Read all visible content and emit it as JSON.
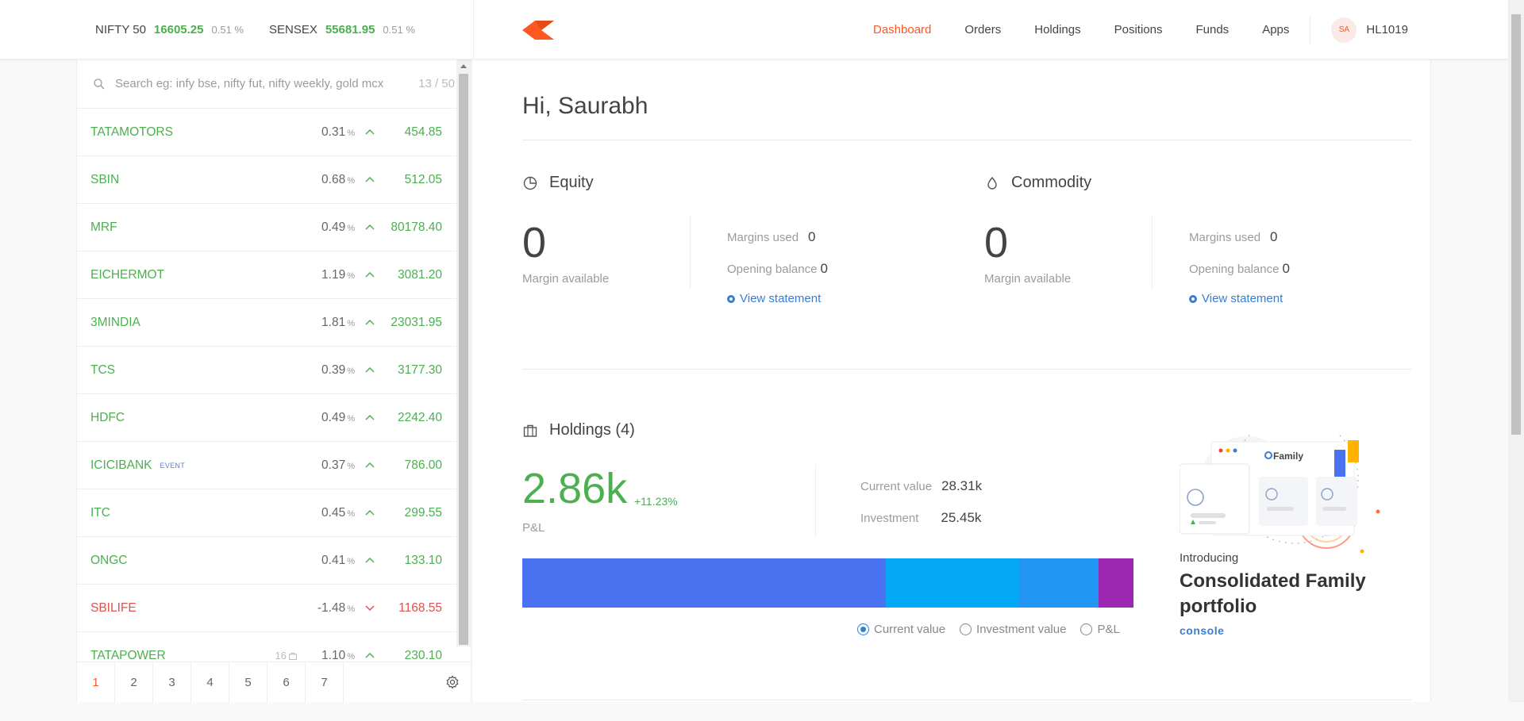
{
  "indices": [
    {
      "name": "NIFTY 50",
      "value": "16605.25",
      "pct": "0.51 %"
    },
    {
      "name": "SENSEX",
      "value": "55681.95",
      "pct": "0.51 %"
    }
  ],
  "nav": {
    "items": [
      "Dashboard",
      "Orders",
      "Holdings",
      "Positions",
      "Funds",
      "Apps"
    ],
    "active": "Dashboard",
    "user_initials": "SA",
    "user_id": "HL1019"
  },
  "colors": {
    "accent": "#ff5722",
    "up": "#4caf50",
    "down": "#df514c",
    "link": "#387ed1"
  },
  "search": {
    "placeholder": "Search eg: infy bse, nifty fut, nifty weekly, gold mcx",
    "count": "13 / 50"
  },
  "watchlist": [
    {
      "symbol": "TATAMOTORS",
      "change": "0.31",
      "unit": "%",
      "direction": "up",
      "ltp": "454.85"
    },
    {
      "symbol": "SBIN",
      "change": "0.68",
      "unit": "%",
      "direction": "up",
      "ltp": "512.05"
    },
    {
      "symbol": "MRF",
      "change": "0.49",
      "unit": "%",
      "direction": "up",
      "ltp": "80178.40"
    },
    {
      "symbol": "EICHERMOT",
      "change": "1.19",
      "unit": "%",
      "direction": "up",
      "ltp": "3081.20"
    },
    {
      "symbol": "3MINDIA",
      "change": "1.81",
      "unit": "%",
      "direction": "up",
      "ltp": "23031.95"
    },
    {
      "symbol": "TCS",
      "change": "0.39",
      "unit": "%",
      "direction": "up",
      "ltp": "3177.30"
    },
    {
      "symbol": "HDFC",
      "change": "0.49",
      "unit": "%",
      "direction": "up",
      "ltp": "2242.40"
    },
    {
      "symbol": "ICICIBANK",
      "badge": "EVENT",
      "change": "0.37",
      "unit": "%",
      "direction": "up",
      "ltp": "786.00"
    },
    {
      "symbol": "ITC",
      "change": "0.45",
      "unit": "%",
      "direction": "up",
      "ltp": "299.55"
    },
    {
      "symbol": "ONGC",
      "change": "0.41",
      "unit": "%",
      "direction": "up",
      "ltp": "133.10"
    },
    {
      "symbol": "SBILIFE",
      "change": "-1.48",
      "unit": "%",
      "direction": "down",
      "ltp": "1168.55"
    },
    {
      "symbol": "TATAPOWER",
      "holdings": "16",
      "change": "1.10",
      "unit": "%",
      "direction": "up",
      "ltp": "230.10"
    }
  ],
  "pager": {
    "pages": [
      "1",
      "2",
      "3",
      "4",
      "5",
      "6",
      "7"
    ],
    "active": "1"
  },
  "greeting": "Hi, Saurabh",
  "equity": {
    "title": "Equity",
    "margin_available": "0",
    "margin_available_label": "Margin available",
    "margins_used_label": "Margins used",
    "margins_used": "0",
    "opening_balance_label": "Opening balance",
    "opening_balance": "0",
    "view_statement": "View statement"
  },
  "commodity": {
    "title": "Commodity",
    "margin_available": "0",
    "margin_available_label": "Margin available",
    "margins_used_label": "Margins used",
    "margins_used": "0",
    "opening_balance_label": "Opening balance",
    "opening_balance": "0",
    "view_statement": "View statement"
  },
  "holdings": {
    "title": "Holdings (4)",
    "pnl": "2.86k",
    "pnl_pct": "+11.23%",
    "pnl_label": "P&L",
    "current_value_label": "Current value",
    "current_value": "28.31k",
    "investment_label": "Investment",
    "investment": "25.45k",
    "bar_segments": [
      {
        "share": 0.595,
        "color": "#4a72f0"
      },
      {
        "share": 0.218,
        "color": "#03a9f4"
      },
      {
        "share": 0.13,
        "color": "#2196f3"
      },
      {
        "share": 0.057,
        "color": "#9c27b0"
      }
    ],
    "radio_options": [
      "Current value",
      "Investment value",
      "P&L"
    ],
    "radio_selected": "Current value"
  },
  "promo": {
    "card_label": "Family",
    "intro": "Introducing",
    "headline": "Consolidated Family portfolio",
    "brand": "console"
  }
}
